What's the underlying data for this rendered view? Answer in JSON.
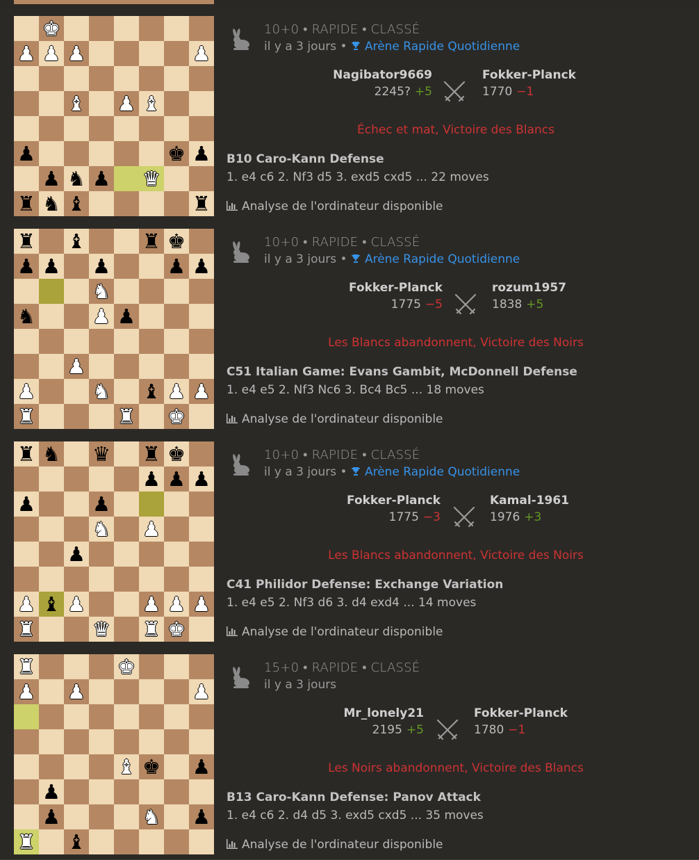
{
  "games": [
    {
      "board": [
        ". K . . . . . .",
        "P P P . . . . P",
        ". . . . . . . .",
        ". . B . P B . .",
        ". . . . . . . .",
        "p . . . . . k p",
        ". p n p . Q . .",
        "r n b . . . . r"
      ],
      "highlights": [
        [
          6,
          4,
          "hl"
        ],
        [
          6,
          5,
          "hl"
        ]
      ],
      "speed": "10+0 • RAPIDE • CLASSÉ",
      "time_ago": "il y a 3 jours",
      "tournament": "Arène Rapide Quotidienne",
      "white": {
        "name": "Nagibator9669",
        "rating": "2245?",
        "diff": "+5"
      },
      "black": {
        "name": "Fokker-Planck",
        "rating": "1770",
        "diff": "−1"
      },
      "result": "Échec et mat, Victoire des Blancs",
      "opening": "B10 Caro-Kann Defense",
      "moves": "1. e4 c6 2. Nf3 d5 3. exd5 cxd5 ... 22 moves",
      "analysis": "Analyse de l'ordinateur disponible"
    },
    {
      "board": [
        "r . b . . r k .",
        "p p . p . . p p",
        ". . . N . . . .",
        "n . . P p . . .",
        ". . . . . . . .",
        ". . P . . . . .",
        "P . . N . b P P",
        "R . . . R . K ."
      ],
      "highlights": [
        [
          2,
          1,
          "hd"
        ]
      ],
      "speed": "10+0 • RAPIDE • CLASSÉ",
      "time_ago": "il y a 3 jours",
      "tournament": "Arène Rapide Quotidienne",
      "white": {
        "name": "Fokker-Planck",
        "rating": "1775",
        "diff": "−5"
      },
      "black": {
        "name": "rozum1957",
        "rating": "1838",
        "diff": "+5"
      },
      "result": "Les Blancs abandonnent, Victoire des Noirs",
      "opening": "C51 Italian Game: Evans Gambit, McDonnell Defense",
      "moves": "1. e4 e5 2. Nf3 Nc6 3. Bc4 Bc5 ... 18 moves",
      "analysis": "Analyse de l'ordinateur disponible"
    },
    {
      "board": [
        "r n . q . r k .",
        ". . . . . p p p",
        "p . . p . . . .",
        ". . . N . P . .",
        ". . p . . . . .",
        ". . . . . . . .",
        "P b P . . P P P",
        "R . . Q . R K ."
      ],
      "highlights": [
        [
          2,
          5,
          "hd"
        ],
        [
          6,
          1,
          "hd"
        ]
      ],
      "speed": "10+0 • RAPIDE • CLASSÉ",
      "time_ago": "il y a 3 jours",
      "tournament": "Arène Rapide Quotidienne",
      "white": {
        "name": "Fokker-Planck",
        "rating": "1775",
        "diff": "−3"
      },
      "black": {
        "name": "Kamal-1961",
        "rating": "1976",
        "diff": "+3"
      },
      "result": "Les Blancs abandonnent, Victoire des Noirs",
      "opening": "C41 Philidor Defense: Exchange Variation",
      "moves": "1. e4 e5 2. Nf3 d6 3. d4 exd4 ... 14 moves",
      "analysis": "Analyse de l'ordinateur disponible"
    },
    {
      "board": [
        "R . . . K . . .",
        "P . P . . . . P",
        ". . . . . . . .",
        ". . . . . . . .",
        ". . . . B k . p",
        ". p . . . . . .",
        ". p . . . N . p",
        "R . b . . . . ."
      ],
      "highlights": [
        [
          2,
          0,
          "hl"
        ],
        [
          7,
          0,
          "hl"
        ]
      ],
      "speed": "15+0 • RAPIDE • CLASSÉ",
      "time_ago": "il y a 3 jours",
      "tournament": "",
      "white": {
        "name": "Mr_lonely21",
        "rating": "2195",
        "diff": "+5"
      },
      "black": {
        "name": "Fokker-Planck",
        "rating": "1780",
        "diff": "−1"
      },
      "result": "Les Noirs abandonnent, Victoire des Blancs",
      "opening": "B13 Caro-Kann Defense: Panov Attack",
      "moves": "1. e4 c6 2. d4 d5 3. exd5 cxd5 ... 35 moves",
      "analysis": "Analyse de l'ordinateur disponible"
    }
  ],
  "colors": {
    "accent_link": "#3692e7",
    "loss": "#cc3333",
    "gain": "#629924",
    "light_square": "#f0d9b5",
    "dark_square": "#b58863"
  },
  "icons": {
    "speed": "rabbit-icon",
    "vs": "crossed-swords-icon",
    "tournament": "trophy-icon",
    "analysis": "bar-chart-icon"
  }
}
